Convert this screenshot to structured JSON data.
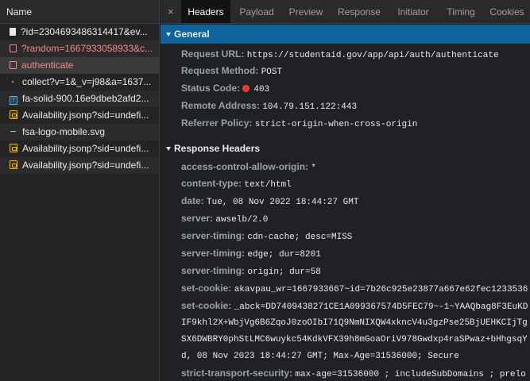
{
  "left_panel": {
    "header": "Name",
    "requests": [
      {
        "icon": "document-icon",
        "name": "?id=2304693486314417&ev...",
        "color": "normal"
      },
      {
        "icon": "document-icon",
        "name": "?random=1667933058933&c...",
        "color": "red"
      },
      {
        "icon": "document-icon",
        "name": "authenticate",
        "color": "red"
      },
      {
        "icon": "dot-icon",
        "name": "collect?v=1&_v=j98&a=1637...",
        "color": "normal"
      },
      {
        "icon": "font-icon",
        "name": "fa-solid-900.16e9dbeb2afd2...",
        "color": "normal"
      },
      {
        "icon": "script-icon",
        "name": "Availability.jsonp?sid=undefi...",
        "color": "normal"
      },
      {
        "icon": "dash-icon",
        "name": "fsa-logo-mobile.svg",
        "color": "normal"
      },
      {
        "icon": "script-icon",
        "name": "Availability.jsonp?sid=undefi...",
        "color": "normal"
      },
      {
        "icon": "script-icon",
        "name": "Availability.jsonp?sid=undefi...",
        "color": "normal"
      }
    ]
  },
  "tabs": {
    "close": "×",
    "items": [
      "Headers",
      "Payload",
      "Preview",
      "Response",
      "Initiator",
      "Timing",
      "Cookies"
    ],
    "active": "Headers"
  },
  "general": {
    "title": "General",
    "rows": [
      {
        "key": "Request URL:",
        "value": "https://studentaid.gov/app/api/auth/authenticate"
      },
      {
        "key": "Request Method:",
        "value": "POST"
      },
      {
        "key": "Status Code:",
        "value": "403"
      },
      {
        "key": "Remote Address:",
        "value": "104.79.151.122:443"
      },
      {
        "key": "Referrer Policy:",
        "value": "strict-origin-when-cross-origin"
      }
    ]
  },
  "response_headers": {
    "title": "Response Headers",
    "rows": [
      {
        "key": "access-control-allow-origin:",
        "value": "*"
      },
      {
        "key": "content-type:",
        "value": "text/html"
      },
      {
        "key": "date:",
        "value": "Tue, 08 Nov 2022 18:44:27 GMT"
      },
      {
        "key": "server:",
        "value": "awselb/2.0"
      },
      {
        "key": "server-timing:",
        "value": "cdn-cache; desc=MISS"
      },
      {
        "key": "server-timing:",
        "value": "edge; dur=8201"
      },
      {
        "key": "server-timing:",
        "value": "origin; dur=58"
      },
      {
        "key": "set-cookie:",
        "value": "akavpau_wr=1667933667~id=7b26c925e23877a667e62fec1233536"
      },
      {
        "key": "set-cookie:",
        "value": "_abck=DD7409438271CE1A099367574D5FEC79~-1~YAAQbag8F3EuKD"
      }
    ],
    "cookie_continuation": [
      "IF9khl2X+WbjVg6B6ZqoJ0zoOIbI71Q9NmNIXQW4xkncV4u3gzPse25BjUEHKCIjTg",
      "SX6DWBRY0phStLMC6wuykc54KdkVFX39h8mGoaOriV978Gwdxp4raSPwaz+bHhgsqY",
      "d, 08 Nov 2023 18:44:27 GMT; Max-Age=31536000; Secure"
    ],
    "last_row": {
      "key": "strict-transport-security:",
      "value": "max-age=31536000 ; includeSubDomains ; prelo"
    }
  },
  "colors": {
    "selected_section": "#0e639c",
    "error_text": "#f28b82",
    "status_error": "#e33a2e"
  }
}
